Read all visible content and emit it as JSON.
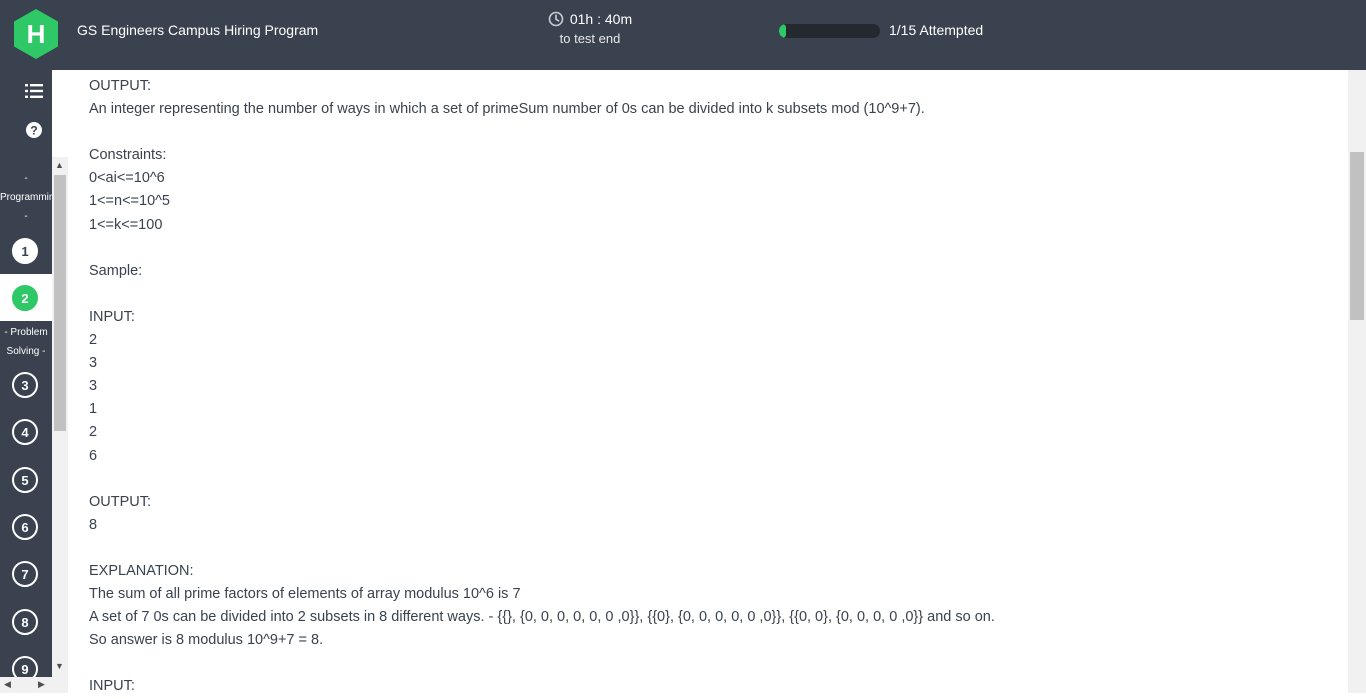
{
  "header": {
    "app_title": "GS Engineers Campus Hiring Program",
    "timer": "01h : 40m",
    "timer_sub": "to test end",
    "progress_fraction": 0.067,
    "attempted": "1/15 Attempted",
    "logo_letter": "H"
  },
  "colors": {
    "topbar": "#39424e",
    "accent": "#2ec866"
  },
  "sidebar": {
    "menu_icon": "list-icon",
    "help_icon": "help-icon",
    "section1_top": "-",
    "section1_mid": "Programmin",
    "section1_bot": "-",
    "section2_line1": "- Problem",
    "section2_line2": "Solving -",
    "questions": [
      "1",
      "2",
      "3",
      "4",
      "5",
      "6",
      "7",
      "8",
      "9"
    ]
  },
  "content": {
    "output_heading": "OUTPUT:",
    "output_desc": "An integer representing the number of ways in which a set of primeSum number of 0s can be divided into k subsets mod (10^9+7).",
    "constraints_heading": "Constraints:",
    "constraints": [
      "0<ai<=10^6",
      "1<=n<=10^5",
      "1<=k<=100"
    ],
    "sample_heading": "Sample:",
    "input_heading": "INPUT:",
    "input_values": [
      "2",
      "3",
      "3",
      "1",
      "2",
      "6"
    ],
    "output_heading2": "OUTPUT:",
    "output_value": "8",
    "explanation_heading": "EXPLANATION:",
    "explanation": [
      "The sum of all prime factors of elements of array modulus 10^6 is 7",
      "A set of 7 0s can be divided into 2 subsets in 8 different ways. - {{}, {0, 0, 0, 0, 0, 0 ,0}}, {{0}, {0, 0, 0, 0, 0 ,0}}, {{0, 0}, {0, 0, 0, 0 ,0}} and so on.",
      "So answer is 8 modulus 10^9+7 = 8."
    ],
    "input_heading2": "INPUT:"
  }
}
